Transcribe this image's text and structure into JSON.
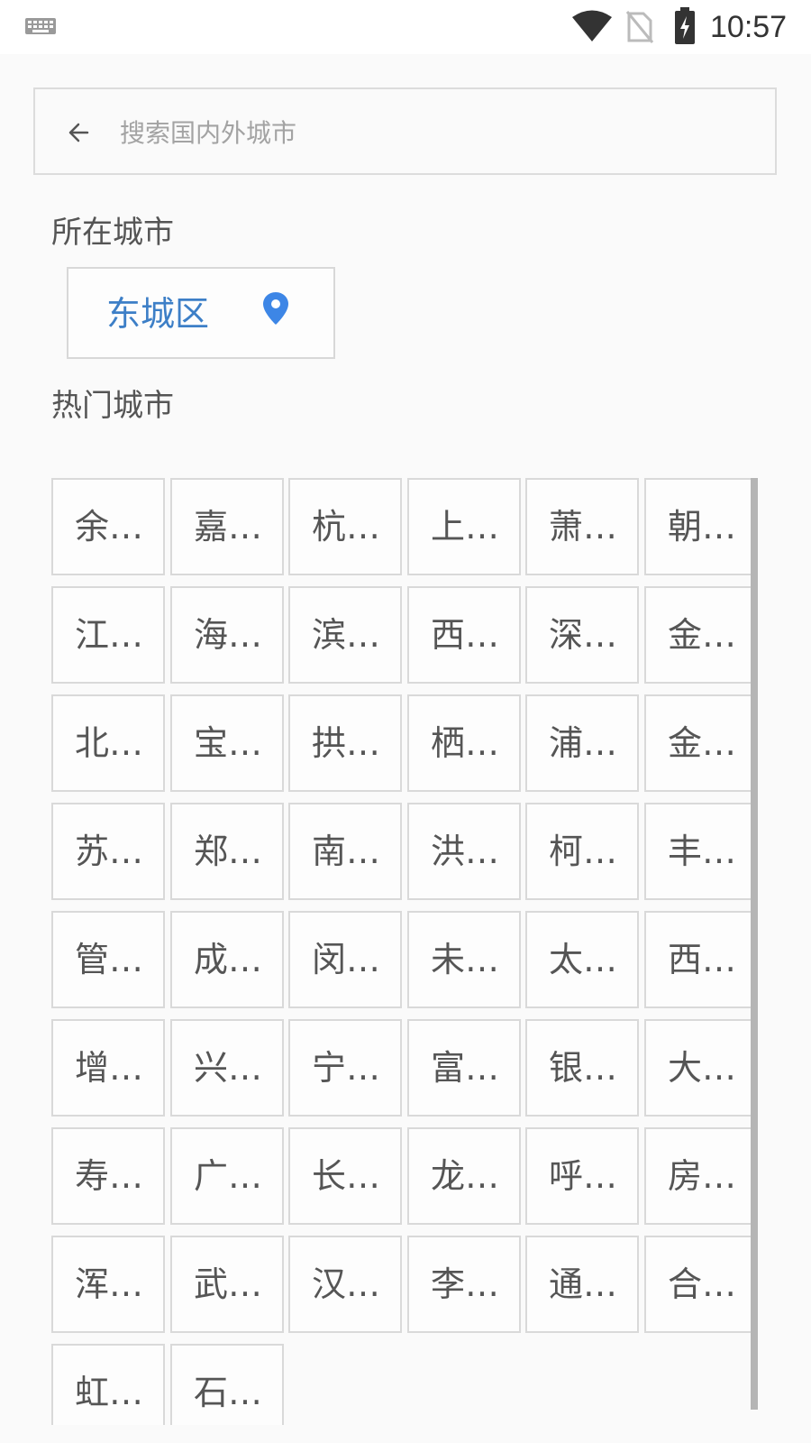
{
  "status_bar": {
    "time": "10:57",
    "icons": [
      "keyboard-icon",
      "wifi-icon",
      "no-sim-icon",
      "battery-charging-icon"
    ]
  },
  "search": {
    "placeholder": "搜索国内外城市",
    "value": ""
  },
  "current_city": {
    "title": "所在城市",
    "name": "东城区",
    "icon": "location-pin-icon"
  },
  "hot_cities": {
    "title": "热门城市",
    "items": [
      "余…",
      "嘉…",
      "杭…",
      "上…",
      "萧…",
      "朝…",
      "江…",
      "海…",
      "滨…",
      "西…",
      "深…",
      "金…",
      "北…",
      "宝…",
      "拱…",
      "栖…",
      "浦…",
      "金…",
      "苏…",
      "郑…",
      "南…",
      "洪…",
      "柯…",
      "丰…",
      "管…",
      "成…",
      "闵…",
      "未…",
      "太…",
      "西…",
      "增…",
      "兴…",
      "宁…",
      "富…",
      "银…",
      "大…",
      "寿…",
      "广…",
      "长…",
      "龙…",
      "呼…",
      "房…",
      "浑…",
      "武…",
      "汉…",
      "李…",
      "通…",
      "合…",
      "虹…",
      "石…"
    ]
  },
  "colors": {
    "accent": "#3d7fc7",
    "background": "#fafafa",
    "border": "#d9d9d9",
    "text": "#555555"
  }
}
